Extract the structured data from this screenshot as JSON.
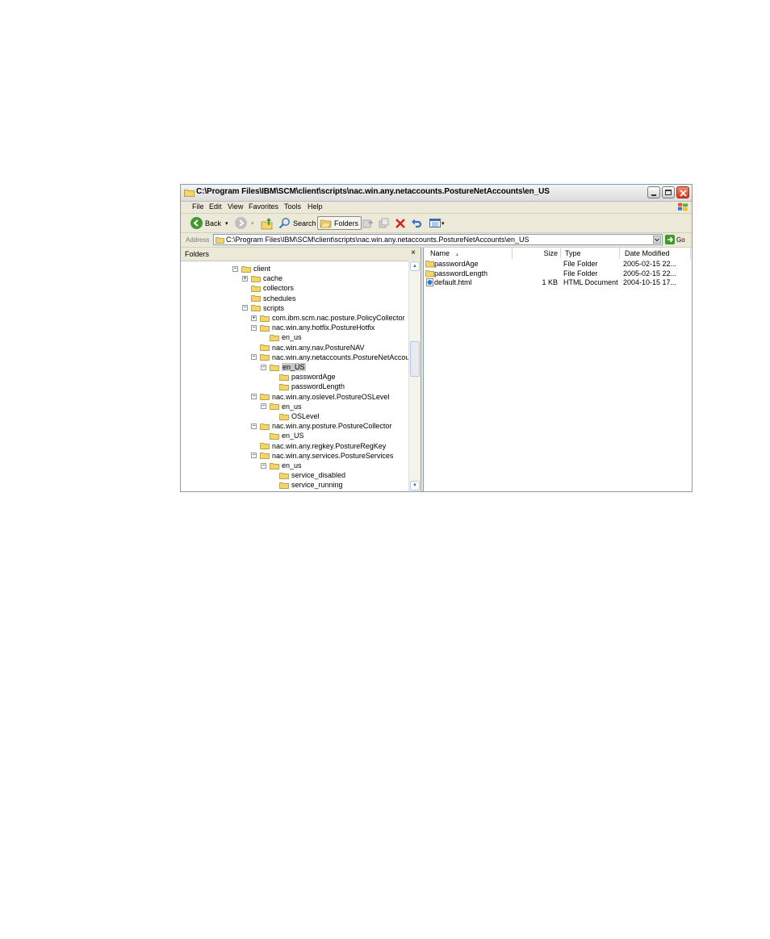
{
  "window": {
    "title": "C:\\Program Files\\IBM\\SCM\\client\\scripts\\nac.win.any.netaccounts.PostureNetAccounts\\en_US"
  },
  "menu": [
    "File",
    "Edit",
    "View",
    "Favorites",
    "Tools",
    "Help"
  ],
  "toolbar": {
    "back_label": "Back",
    "search_label": "Search",
    "folders_label": "Folders"
  },
  "address": {
    "label": "Address",
    "value": "C:\\Program Files\\IBM\\SCM\\client\\scripts\\nac.win.any.netaccounts.PostureNetAccounts\\en_US",
    "go_label": "Go"
  },
  "folders_pane": {
    "title": "Folders",
    "close_glyph": "×",
    "tree": [
      {
        "name": "client",
        "expander": "minus"
      },
      {
        "name": "cache",
        "expander": "plus"
      },
      {
        "name": "collectors",
        "expander": "none"
      },
      {
        "name": "schedules",
        "expander": "none"
      },
      {
        "name": "scripts",
        "expander": "minus"
      },
      {
        "name": "com.ibm.scm.nac.posture.PolicyCollector",
        "expander": "plus"
      },
      {
        "name": "nac.win.any.hotfix.PostureHotfix",
        "expander": "minus"
      },
      {
        "name": "en_us",
        "expander": "none"
      },
      {
        "name": "nac.win.any.nav.PostureNAV",
        "expander": "none"
      },
      {
        "name": "nac.win.any.netaccounts.PostureNetAccounts",
        "expander": "minus"
      },
      {
        "name": "en_US",
        "expander": "minus",
        "selected": true
      },
      {
        "name": "passwordAge",
        "expander": "none"
      },
      {
        "name": "passwordLength",
        "expander": "none"
      },
      {
        "name": "nac.win.any.oslevel.PostureOSLevel",
        "expander": "minus"
      },
      {
        "name": "en_us",
        "expander": "minus"
      },
      {
        "name": "OSLevel",
        "expander": "none"
      },
      {
        "name": "nac.win.any.posture.PostureCollector",
        "expander": "minus"
      },
      {
        "name": "en_US",
        "expander": "none"
      },
      {
        "name": "nac.win.any.regkey.PostureRegKey",
        "expander": "none"
      },
      {
        "name": "nac.win.any.services.PostureServices",
        "expander": "minus"
      },
      {
        "name": "en_us",
        "expander": "minus"
      },
      {
        "name": "service_disabled",
        "expander": "none"
      },
      {
        "name": "service_running",
        "expander": "none"
      }
    ]
  },
  "files_pane": {
    "columns": {
      "name": "Name",
      "sort_glyph": "▲",
      "size": "Size",
      "type": "Type",
      "date": "Date Modified"
    },
    "rows": [
      {
        "name": "passwordAge",
        "size": "",
        "type": "File Folder",
        "date": "2005-02-15 22...",
        "icon": "folder-icon"
      },
      {
        "name": "passwordLength",
        "size": "",
        "type": "File Folder",
        "date": "2005-02-15 22...",
        "icon": "folder-icon"
      },
      {
        "name": "default.html",
        "size": "1 KB",
        "type": "HTML Document",
        "date": "2004-10-15 17...",
        "icon": "html-document-icon"
      }
    ]
  },
  "colors": {
    "back_green": "#3c9a2e",
    "delete_red": "#d42020",
    "folder_yellow": "#f5d46a",
    "selection": "#c8c8c8"
  }
}
